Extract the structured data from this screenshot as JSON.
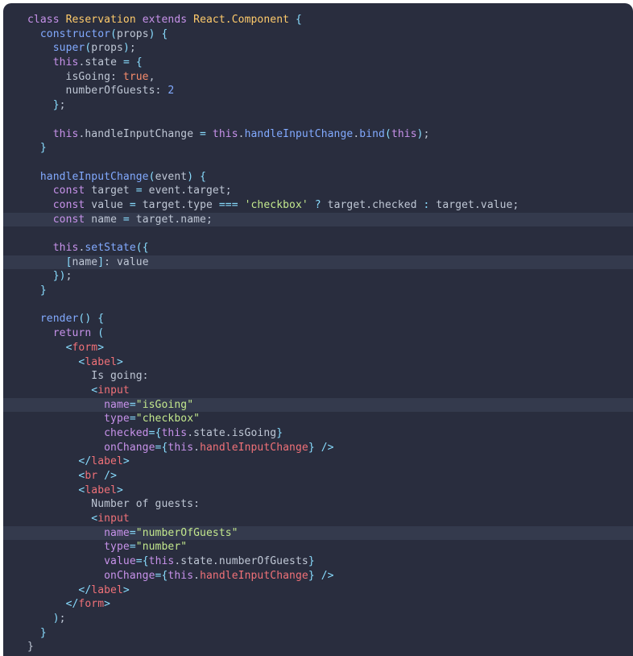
{
  "window": {
    "type": "code-snippet",
    "language": "jsx",
    "theme": "material-palenight",
    "background": "#292d3e",
    "highlight_background": "#343a4d",
    "page_background": "#ffffff",
    "default_text_color": "#bfc7d5"
  },
  "palette": {
    "keyword": "#c792ea",
    "class_name": "#ffcb6b",
    "function": "#82aaff",
    "number": "#82aaff",
    "boolean": "#f78c6c",
    "string": "#c3e88d",
    "punctuation": "#89ddff",
    "jsx_tag": "#f07178",
    "jsx_bracket": "#89ddff",
    "attribute": "#c792ea",
    "plain": "#bfc7d5"
  },
  "code": {
    "full_text": "class Reservation extends React.Component {\n  constructor(props) {\n    super(props);\n    this.state = {\n      isGoing: true,\n      numberOfGuests: 2\n    };\n\n    this.handleInputChange = this.handleInputChange.bind(this);\n  }\n\n  handleInputChange(event) {\n    const target = event.target;\n    const value = target.type === 'checkbox' ? target.checked : target.value;\n    const name = target.name;\n\n    this.setState({\n      [name]: value\n    });\n  }\n\n  render() {\n    return (\n      <form>\n        <label>\n          Is going:\n          <input\n            name=\"isGoing\"\n            type=\"checkbox\"\n            checked={this.state.isGoing}\n            onChange={this.handleInputChange} />\n        </label>\n        <br />\n        <label>\n          Number of guests:\n          <input\n            name=\"numberOfGuests\"\n            type=\"number\"\n            value={this.state.numberOfGuests}\n            onChange={this.handleInputChange} />\n        </label>\n      </form>\n    );\n  }\n}",
    "highlighted_line_numbers": [
      15,
      18,
      28,
      38
    ],
    "lines": [
      {
        "n": 1,
        "text": "class Reservation extends React.Component {",
        "highlight": false
      },
      {
        "n": 2,
        "text": "  constructor(props) {",
        "highlight": false
      },
      {
        "n": 3,
        "text": "    super(props);",
        "highlight": false
      },
      {
        "n": 4,
        "text": "    this.state = {",
        "highlight": false
      },
      {
        "n": 5,
        "text": "      isGoing: true,",
        "highlight": false
      },
      {
        "n": 6,
        "text": "      numberOfGuests: 2",
        "highlight": false
      },
      {
        "n": 7,
        "text": "    };",
        "highlight": false
      },
      {
        "n": 8,
        "text": "",
        "highlight": false
      },
      {
        "n": 9,
        "text": "    this.handleInputChange = this.handleInputChange.bind(this);",
        "highlight": false
      },
      {
        "n": 10,
        "text": "  }",
        "highlight": false
      },
      {
        "n": 11,
        "text": "",
        "highlight": false
      },
      {
        "n": 12,
        "text": "  handleInputChange(event) {",
        "highlight": false
      },
      {
        "n": 13,
        "text": "    const target = event.target;",
        "highlight": false
      },
      {
        "n": 14,
        "text": "    const value = target.type === 'checkbox' ? target.checked : target.value;",
        "highlight": false
      },
      {
        "n": 15,
        "text": "    const name = target.name;",
        "highlight": true
      },
      {
        "n": 16,
        "text": "",
        "highlight": false
      },
      {
        "n": 17,
        "text": "    this.setState({",
        "highlight": false
      },
      {
        "n": 18,
        "text": "      [name]: value",
        "highlight": true
      },
      {
        "n": 19,
        "text": "    });",
        "highlight": false
      },
      {
        "n": 20,
        "text": "  }",
        "highlight": false
      },
      {
        "n": 21,
        "text": "",
        "highlight": false
      },
      {
        "n": 22,
        "text": "  render() {",
        "highlight": false
      },
      {
        "n": 23,
        "text": "    return (",
        "highlight": false
      },
      {
        "n": 24,
        "text": "      <form>",
        "highlight": false
      },
      {
        "n": 25,
        "text": "        <label>",
        "highlight": false
      },
      {
        "n": 26,
        "text": "          Is going:",
        "highlight": false
      },
      {
        "n": 27,
        "text": "          <input",
        "highlight": false
      },
      {
        "n": 28,
        "text": "            name=\"isGoing\"",
        "highlight": true
      },
      {
        "n": 29,
        "text": "            type=\"checkbox\"",
        "highlight": false
      },
      {
        "n": 30,
        "text": "            checked={this.state.isGoing}",
        "highlight": false
      },
      {
        "n": 31,
        "text": "            onChange={this.handleInputChange} />",
        "highlight": false
      },
      {
        "n": 32,
        "text": "        </label>",
        "highlight": false
      },
      {
        "n": 33,
        "text": "        <br />",
        "highlight": false
      },
      {
        "n": 34,
        "text": "        <label>",
        "highlight": false
      },
      {
        "n": 35,
        "text": "          Number of guests:",
        "highlight": false
      },
      {
        "n": 36,
        "text": "          <input",
        "highlight": false
      },
      {
        "n": 37,
        "text": "            name=\"numberOfGuests\"",
        "highlight": true
      },
      {
        "n": 38,
        "text": "            type=\"number\"",
        "highlight": false
      },
      {
        "n": 39,
        "text": "            value={this.state.numberOfGuests}",
        "highlight": false
      },
      {
        "n": 40,
        "text": "            onChange={this.handleInputChange} />",
        "highlight": false
      },
      {
        "n": 41,
        "text": "        </label>",
        "highlight": false
      },
      {
        "n": 42,
        "text": "      </form>",
        "highlight": false
      },
      {
        "n": 43,
        "text": "    );",
        "highlight": false
      },
      {
        "n": 44,
        "text": "  }",
        "highlight": false
      },
      {
        "n": 45,
        "text": "}",
        "highlight": false
      }
    ],
    "tokens": [
      [
        [
          "kw",
          "class"
        ],
        [
          "txt",
          " "
        ],
        [
          "cls",
          "Reservation"
        ],
        [
          "txt",
          " "
        ],
        [
          "kw",
          "extends"
        ],
        [
          "txt",
          " "
        ],
        [
          "cls",
          "React.Component"
        ],
        [
          "txt",
          " "
        ],
        [
          "pun",
          "{"
        ]
      ],
      [
        [
          "txt",
          "  "
        ],
        [
          "fn",
          "constructor"
        ],
        [
          "pun",
          "("
        ],
        [
          "txt",
          "props"
        ],
        [
          "pun",
          ")"
        ],
        [
          "txt",
          " "
        ],
        [
          "pun",
          "{"
        ]
      ],
      [
        [
          "txt",
          "    "
        ],
        [
          "fn",
          "super"
        ],
        [
          "pun",
          "("
        ],
        [
          "txt",
          "props"
        ],
        [
          "pun",
          ")"
        ],
        [
          "txt",
          ";"
        ]
      ],
      [
        [
          "txt",
          "    "
        ],
        [
          "kw",
          "this"
        ],
        [
          "txt",
          ".state "
        ],
        [
          "op",
          "="
        ],
        [
          "txt",
          " "
        ],
        [
          "pun",
          "{"
        ]
      ],
      [
        [
          "txt",
          "      isGoing: "
        ],
        [
          "bool",
          "true"
        ],
        [
          "txt",
          ","
        ]
      ],
      [
        [
          "txt",
          "      numberOfGuests: "
        ],
        [
          "num",
          "2"
        ]
      ],
      [
        [
          "txt",
          "    "
        ],
        [
          "pun",
          "}"
        ],
        [
          "txt",
          ";"
        ]
      ],
      [
        [
          "txt",
          ""
        ]
      ],
      [
        [
          "txt",
          "    "
        ],
        [
          "kw",
          "this"
        ],
        [
          "txt",
          ".handleInputChange "
        ],
        [
          "op",
          "="
        ],
        [
          "txt",
          " "
        ],
        [
          "kw",
          "this"
        ],
        [
          "txt",
          "."
        ],
        [
          "fn",
          "handleInputChange"
        ],
        [
          "txt",
          "."
        ],
        [
          "fn",
          "bind"
        ],
        [
          "pun",
          "("
        ],
        [
          "kw",
          "this"
        ],
        [
          "pun",
          ")"
        ],
        [
          "txt",
          ";"
        ]
      ],
      [
        [
          "txt",
          "  "
        ],
        [
          "pun",
          "}"
        ]
      ],
      [
        [
          "txt",
          ""
        ]
      ],
      [
        [
          "txt",
          "  "
        ],
        [
          "fn",
          "handleInputChange"
        ],
        [
          "pun",
          "("
        ],
        [
          "txt",
          "event"
        ],
        [
          "pun",
          ")"
        ],
        [
          "txt",
          " "
        ],
        [
          "pun",
          "{"
        ]
      ],
      [
        [
          "txt",
          "    "
        ],
        [
          "kw",
          "const"
        ],
        [
          "txt",
          " target "
        ],
        [
          "op",
          "="
        ],
        [
          "txt",
          " event.target;"
        ]
      ],
      [
        [
          "txt",
          "    "
        ],
        [
          "kw",
          "const"
        ],
        [
          "txt",
          " value "
        ],
        [
          "op",
          "="
        ],
        [
          "txt",
          " target.type "
        ],
        [
          "op",
          "==="
        ],
        [
          "txt",
          " "
        ],
        [
          "str",
          "'checkbox'"
        ],
        [
          "txt",
          " "
        ],
        [
          "op",
          "?"
        ],
        [
          "txt",
          " target.checked "
        ],
        [
          "op",
          ":"
        ],
        [
          "txt",
          " target.value;"
        ]
      ],
      [
        [
          "txt",
          "    "
        ],
        [
          "kw",
          "const"
        ],
        [
          "txt",
          " name "
        ],
        [
          "op",
          "="
        ],
        [
          "txt",
          " target.name;"
        ]
      ],
      [
        [
          "txt",
          ""
        ]
      ],
      [
        [
          "txt",
          "    "
        ],
        [
          "kw",
          "this"
        ],
        [
          "txt",
          "."
        ],
        [
          "fn",
          "setState"
        ],
        [
          "pun",
          "({"
        ]
      ],
      [
        [
          "txt",
          "      "
        ],
        [
          "pun",
          "["
        ],
        [
          "txt",
          "name"
        ],
        [
          "pun",
          "]"
        ],
        [
          "txt",
          ": value"
        ]
      ],
      [
        [
          "txt",
          "    "
        ],
        [
          "pun",
          "})"
        ],
        [
          "txt",
          ";"
        ]
      ],
      [
        [
          "txt",
          "  "
        ],
        [
          "pun",
          "}"
        ]
      ],
      [
        [
          "txt",
          ""
        ]
      ],
      [
        [
          "txt",
          "  "
        ],
        [
          "fn",
          "render"
        ],
        [
          "pun",
          "()"
        ],
        [
          "txt",
          " "
        ],
        [
          "pun",
          "{"
        ]
      ],
      [
        [
          "txt",
          "    "
        ],
        [
          "kw",
          "return"
        ],
        [
          "txt",
          " "
        ],
        [
          "pun",
          "("
        ]
      ],
      [
        [
          "txt",
          "      "
        ],
        [
          "tagb",
          "<"
        ],
        [
          "tag",
          "form"
        ],
        [
          "tagb",
          ">"
        ]
      ],
      [
        [
          "txt",
          "        "
        ],
        [
          "tagb",
          "<"
        ],
        [
          "tag",
          "label"
        ],
        [
          "tagb",
          ">"
        ]
      ],
      [
        [
          "txt",
          "          Is going:"
        ]
      ],
      [
        [
          "txt",
          "          "
        ],
        [
          "tagb",
          "<"
        ],
        [
          "tag",
          "input"
        ]
      ],
      [
        [
          "txt",
          "            "
        ],
        [
          "attr",
          "name"
        ],
        [
          "op",
          "="
        ],
        [
          "str",
          "\"isGoing\""
        ]
      ],
      [
        [
          "txt",
          "            "
        ],
        [
          "attr",
          "type"
        ],
        [
          "op",
          "="
        ],
        [
          "str",
          "\"checkbox\""
        ]
      ],
      [
        [
          "txt",
          "            "
        ],
        [
          "attr",
          "checked"
        ],
        [
          "op",
          "="
        ],
        [
          "pun",
          "{"
        ],
        [
          "kw",
          "this"
        ],
        [
          "txt",
          ".state.isGoing"
        ],
        [
          "pun",
          "}"
        ]
      ],
      [
        [
          "txt",
          "            "
        ],
        [
          "attr",
          "onChange"
        ],
        [
          "op",
          "="
        ],
        [
          "pun",
          "{"
        ],
        [
          "kw",
          "this"
        ],
        [
          "txt",
          "."
        ],
        [
          "tag",
          "handleInputChange"
        ],
        [
          "pun",
          "}"
        ],
        [
          "txt",
          " "
        ],
        [
          "tagb",
          "/>"
        ]
      ],
      [
        [
          "txt",
          "        "
        ],
        [
          "tagb",
          "</"
        ],
        [
          "tag",
          "label"
        ],
        [
          "tagb",
          ">"
        ]
      ],
      [
        [
          "txt",
          "        "
        ],
        [
          "tagb",
          "<"
        ],
        [
          "tag",
          "br"
        ],
        [
          "txt",
          " "
        ],
        [
          "tagb",
          "/>"
        ]
      ],
      [
        [
          "txt",
          "        "
        ],
        [
          "tagb",
          "<"
        ],
        [
          "tag",
          "label"
        ],
        [
          "tagb",
          ">"
        ]
      ],
      [
        [
          "txt",
          "          Number of guests:"
        ]
      ],
      [
        [
          "txt",
          "          "
        ],
        [
          "tagb",
          "<"
        ],
        [
          "tag",
          "input"
        ]
      ],
      [
        [
          "txt",
          "            "
        ],
        [
          "attr",
          "name"
        ],
        [
          "op",
          "="
        ],
        [
          "str",
          "\"numberOfGuests\""
        ]
      ],
      [
        [
          "txt",
          "            "
        ],
        [
          "attr",
          "type"
        ],
        [
          "op",
          "="
        ],
        [
          "str",
          "\"number\""
        ]
      ],
      [
        [
          "txt",
          "            "
        ],
        [
          "attr",
          "value"
        ],
        [
          "op",
          "="
        ],
        [
          "pun",
          "{"
        ],
        [
          "kw",
          "this"
        ],
        [
          "txt",
          ".state.numberOfGuests"
        ],
        [
          "pun",
          "}"
        ]
      ],
      [
        [
          "txt",
          "            "
        ],
        [
          "attr",
          "onChange"
        ],
        [
          "op",
          "="
        ],
        [
          "pun",
          "{"
        ],
        [
          "kw",
          "this"
        ],
        [
          "txt",
          "."
        ],
        [
          "tag",
          "handleInputChange"
        ],
        [
          "pun",
          "}"
        ],
        [
          "txt",
          " "
        ],
        [
          "tagb",
          "/>"
        ]
      ],
      [
        [
          "txt",
          "        "
        ],
        [
          "tagb",
          "</"
        ],
        [
          "tag",
          "label"
        ],
        [
          "tagb",
          ">"
        ]
      ],
      [
        [
          "txt",
          "      "
        ],
        [
          "tagb",
          "</"
        ],
        [
          "tag",
          "form"
        ],
        [
          "tagb",
          ">"
        ]
      ],
      [
        [
          "txt",
          "    "
        ],
        [
          "pun",
          ")"
        ],
        [
          "txt",
          ";"
        ]
      ],
      [
        [
          "txt",
          "  "
        ],
        [
          "pun",
          "}"
        ]
      ],
      [
        [
          "txt",
          "}"
        ]
      ]
    ]
  }
}
